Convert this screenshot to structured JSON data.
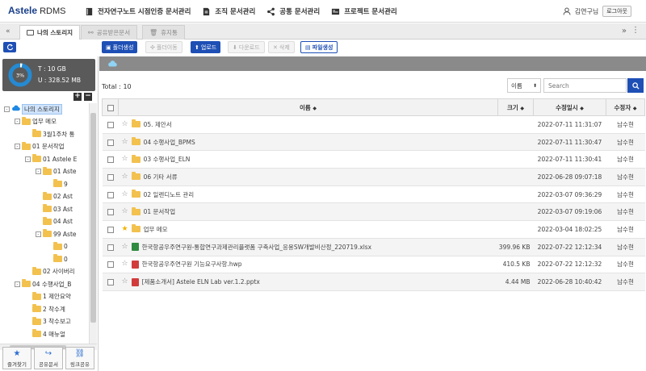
{
  "header": {
    "logo_prefix": "Astele",
    "logo_brand": " RDMS",
    "nav": [
      {
        "label": "전자연구노트 시점인증 문서관리",
        "icon": "book-icon"
      },
      {
        "label": "조직 문서관리",
        "icon": "document-icon"
      },
      {
        "label": "공통 문서관리",
        "icon": "share-icon"
      },
      {
        "label": "프로젝트 문서관리",
        "icon": "project-icon"
      }
    ],
    "user_name": "김연구님",
    "logout_label": "로그아웃"
  },
  "tabs": [
    {
      "label": "나의 스토리지",
      "icon": "folder-icon",
      "active": true
    },
    {
      "label": "공유받은문서",
      "icon": "share-icon",
      "active": false
    },
    {
      "label": "휴지통",
      "icon": "trash-icon",
      "active": false
    }
  ],
  "toolbar": {
    "new_folder": "폴더생성",
    "move_folder": "폴더이동",
    "upload": "업로드",
    "download": "다운로드",
    "delete": "삭제",
    "create_file": "파일생성"
  },
  "storage": {
    "percent_label": "3%",
    "percent": 3,
    "total": "T : 10 GB",
    "used": "U : 328.52 MB"
  },
  "tree": [
    {
      "label": "나의 스토리지",
      "indent": 0,
      "selected": true,
      "type": "cloud",
      "exp": "-"
    },
    {
      "label": "업무 메모",
      "indent": 1,
      "type": "folder",
      "exp": "-"
    },
    {
      "label": "3월1주차 통",
      "indent": 2,
      "type": "folder",
      "exp": ""
    },
    {
      "label": "01 문서작업",
      "indent": 1,
      "type": "folder",
      "exp": "-"
    },
    {
      "label": "01 Astele E",
      "indent": 2,
      "type": "folder",
      "exp": "-"
    },
    {
      "label": "01 Aste",
      "indent": 3,
      "type": "folder",
      "exp": "-"
    },
    {
      "label": "9",
      "indent": 4,
      "type": "folder",
      "exp": ""
    },
    {
      "label": "02 Ast",
      "indent": 3,
      "type": "folder",
      "exp": ""
    },
    {
      "label": "03 Ast",
      "indent": 3,
      "type": "folder",
      "exp": ""
    },
    {
      "label": "04 Ast",
      "indent": 3,
      "type": "folder",
      "exp": ""
    },
    {
      "label": "99 Aste",
      "indent": 3,
      "type": "folder",
      "exp": "-"
    },
    {
      "label": "0",
      "indent": 4,
      "type": "folder",
      "exp": ""
    },
    {
      "label": "0",
      "indent": 4,
      "type": "folder",
      "exp": ""
    },
    {
      "label": "02 사이버리",
      "indent": 2,
      "type": "folder",
      "exp": ""
    },
    {
      "label": "04 수행사업_B",
      "indent": 1,
      "type": "folder",
      "exp": "-"
    },
    {
      "label": "1 제안요약",
      "indent": 2,
      "type": "folder",
      "exp": ""
    },
    {
      "label": "2 착수계",
      "indent": 2,
      "type": "folder",
      "exp": ""
    },
    {
      "label": "3 착수보고",
      "indent": 2,
      "type": "folder",
      "exp": ""
    },
    {
      "label": "4 매뉴얼",
      "indent": 2,
      "type": "folder",
      "exp": ""
    }
  ],
  "sidebar_bottom": [
    {
      "label": "즐겨찾기",
      "icon": "favorites-icon"
    },
    {
      "label": "공유문서",
      "icon": "shared-docs-icon"
    },
    {
      "label": "링크공유",
      "icon": "link-share-icon"
    }
  ],
  "list": {
    "total": "Total : 10",
    "sort_selected": "이름",
    "search_placeholder": "Search",
    "columns": {
      "name": "이름",
      "size": "크기",
      "modified": "수정일시",
      "modifier": "수정자"
    },
    "rows": [
      {
        "name": "05. 제안서",
        "type": "folder",
        "size": "",
        "modified": "2022-07-11 11:31:07",
        "modifier": "남수현",
        "starred": false
      },
      {
        "name": "04 수행사업_BPMS",
        "type": "folder",
        "size": "",
        "modified": "2022-07-11 11:30:47",
        "modifier": "남수현",
        "starred": false
      },
      {
        "name": "03 수행사업_ELN",
        "type": "folder",
        "size": "",
        "modified": "2022-07-11 11:30:41",
        "modifier": "남수현",
        "starred": false
      },
      {
        "name": "06 기타 서류",
        "type": "folder",
        "size": "",
        "modified": "2022-06-28 09:07:18",
        "modifier": "남수현",
        "starred": false
      },
      {
        "name": "02 일렌디노트 관리",
        "type": "folder",
        "size": "",
        "modified": "2022-03-07 09:36:29",
        "modifier": "남수현",
        "starred": false
      },
      {
        "name": "01 문서작업",
        "type": "folder",
        "size": "",
        "modified": "2022-03-07 09:19:06",
        "modifier": "남수현",
        "starred": false
      },
      {
        "name": "업무 메모",
        "type": "folder",
        "size": "",
        "modified": "2022-03-04 18:02:25",
        "modifier": "남수현",
        "starred": true
      },
      {
        "name": "한국항공우주연구원-통합연구과제관리플랫폼 구축사업_응용SW개발비산정_220719.xlsx",
        "type": "xls",
        "size": "399.96 KB",
        "modified": "2022-07-22 12:12:34",
        "modifier": "남수현",
        "starred": false
      },
      {
        "name": "한국항공우주연구원 기능요구사항.hwp",
        "type": "hwp",
        "size": "410.5 KB",
        "modified": "2022-07-22 12:12:32",
        "modifier": "남수현",
        "starred": false
      },
      {
        "name": "[제품소개서] Astele ELN Lab ver.1.2.pptx",
        "type": "ppt",
        "size": "4.44 MB",
        "modified": "2022-06-28 10:40:42",
        "modifier": "남수현",
        "starred": false
      }
    ]
  },
  "colors": {
    "accent": "#1e4fb5",
    "folder": "#f2c14e",
    "star_on": "#f2b400"
  }
}
